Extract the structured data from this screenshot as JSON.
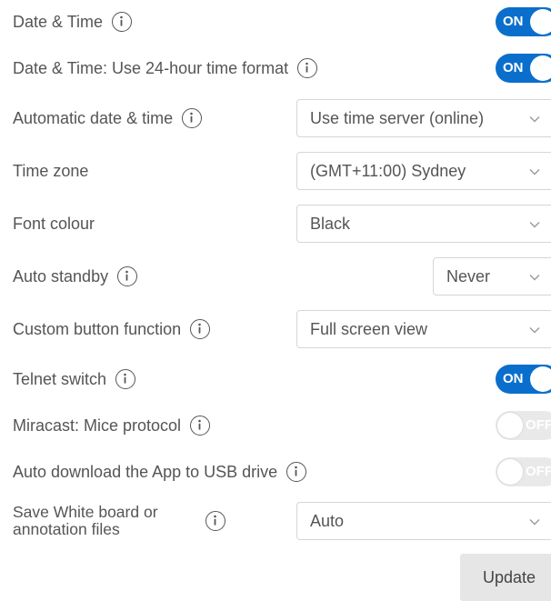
{
  "settings": [
    {
      "label": "Date & Time",
      "control": "toggle",
      "state": "ON"
    },
    {
      "label": "Date & Time: Use 24-hour time format",
      "control": "toggle",
      "state": "ON"
    },
    {
      "label": "Automatic date & time",
      "control": "select",
      "value": "Use time server (online)"
    },
    {
      "label": "Time zone",
      "control": "select",
      "value": "(GMT+11:00) Sydney"
    },
    {
      "label": "Font colour",
      "control": "select",
      "value": "Black"
    },
    {
      "label": "Auto standby",
      "control": "select",
      "value": "Never"
    },
    {
      "label": "Custom button function",
      "control": "select",
      "value": "Full screen view"
    },
    {
      "label": "Telnet switch",
      "control": "toggle",
      "state": "ON"
    },
    {
      "label": "Miracast: Mice protocol",
      "control": "toggle",
      "state": "OFF"
    },
    {
      "label": "Auto download the App to USB drive",
      "control": "toggle",
      "state": "OFF"
    },
    {
      "label": "Save White board or annotation files",
      "control": "select",
      "value": "Auto"
    }
  ],
  "update_button": {
    "label": "Update"
  },
  "icons": {
    "info": "info-circle-icon",
    "dropdown": "chevron-down-icon"
  },
  "colors": {
    "toggle_on": "#0a6fcc",
    "toggle_off": "#e9e9e9",
    "text": "#555555",
    "button_bg": "#e6e6e6"
  }
}
